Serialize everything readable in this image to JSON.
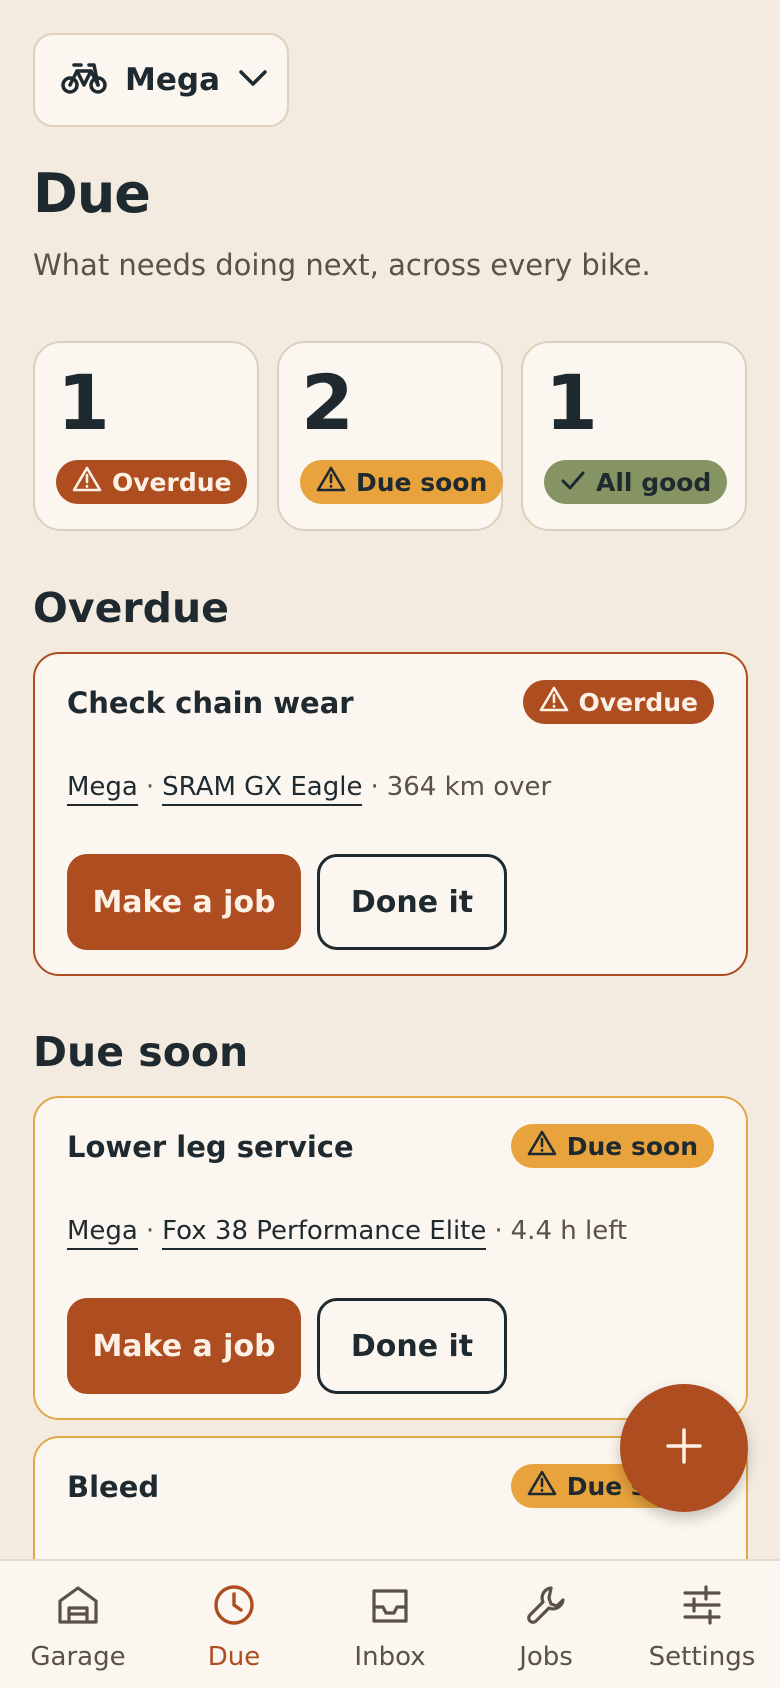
{
  "bike_selector": {
    "name": "Mega",
    "icon": "bike-icon"
  },
  "page": {
    "title": "Due",
    "subtitle": "What needs doing next, across every bike."
  },
  "stats": [
    {
      "count": "1",
      "label": "Overdue",
      "status": "overdue"
    },
    {
      "count": "2",
      "label": "Due soon",
      "status": "soon"
    },
    {
      "count": "1",
      "label": "All good",
      "status": "good"
    }
  ],
  "sections": {
    "overdue_title": "Overdue",
    "due_soon_title": "Due soon"
  },
  "cards": [
    {
      "title": "Check chain wear",
      "badge": "Overdue",
      "bike": "Mega",
      "component": "SRAM GX Eagle",
      "detail": "364 km over",
      "primary_label": "Make a job",
      "secondary_label": "Done it"
    },
    {
      "title": "Lower leg service",
      "badge": "Due soon",
      "bike": "Mega",
      "component": "Fox 38 Performance Elite",
      "detail": "4.4 h left",
      "primary_label": "Make a job",
      "secondary_label": "Done it"
    },
    {
      "title": "Bleed",
      "badge": "Due soon"
    }
  ],
  "fab": {
    "icon": "plus-icon"
  },
  "tabs": [
    {
      "label": "Garage",
      "icon": "garage-icon",
      "active": false
    },
    {
      "label": "Due",
      "icon": "clock-icon",
      "active": true
    },
    {
      "label": "Inbox",
      "icon": "inbox-icon",
      "active": false
    },
    {
      "label": "Jobs",
      "icon": "wrench-icon",
      "active": false
    },
    {
      "label": "Settings",
      "icon": "sliders-icon",
      "active": false
    }
  ],
  "colors": {
    "background": "#f3ebdf",
    "card": "#fbf6ef",
    "overdue": "#ad4d20",
    "due_soon": "#e8a33d",
    "all_good": "#859462",
    "text": "#1f2a30"
  }
}
